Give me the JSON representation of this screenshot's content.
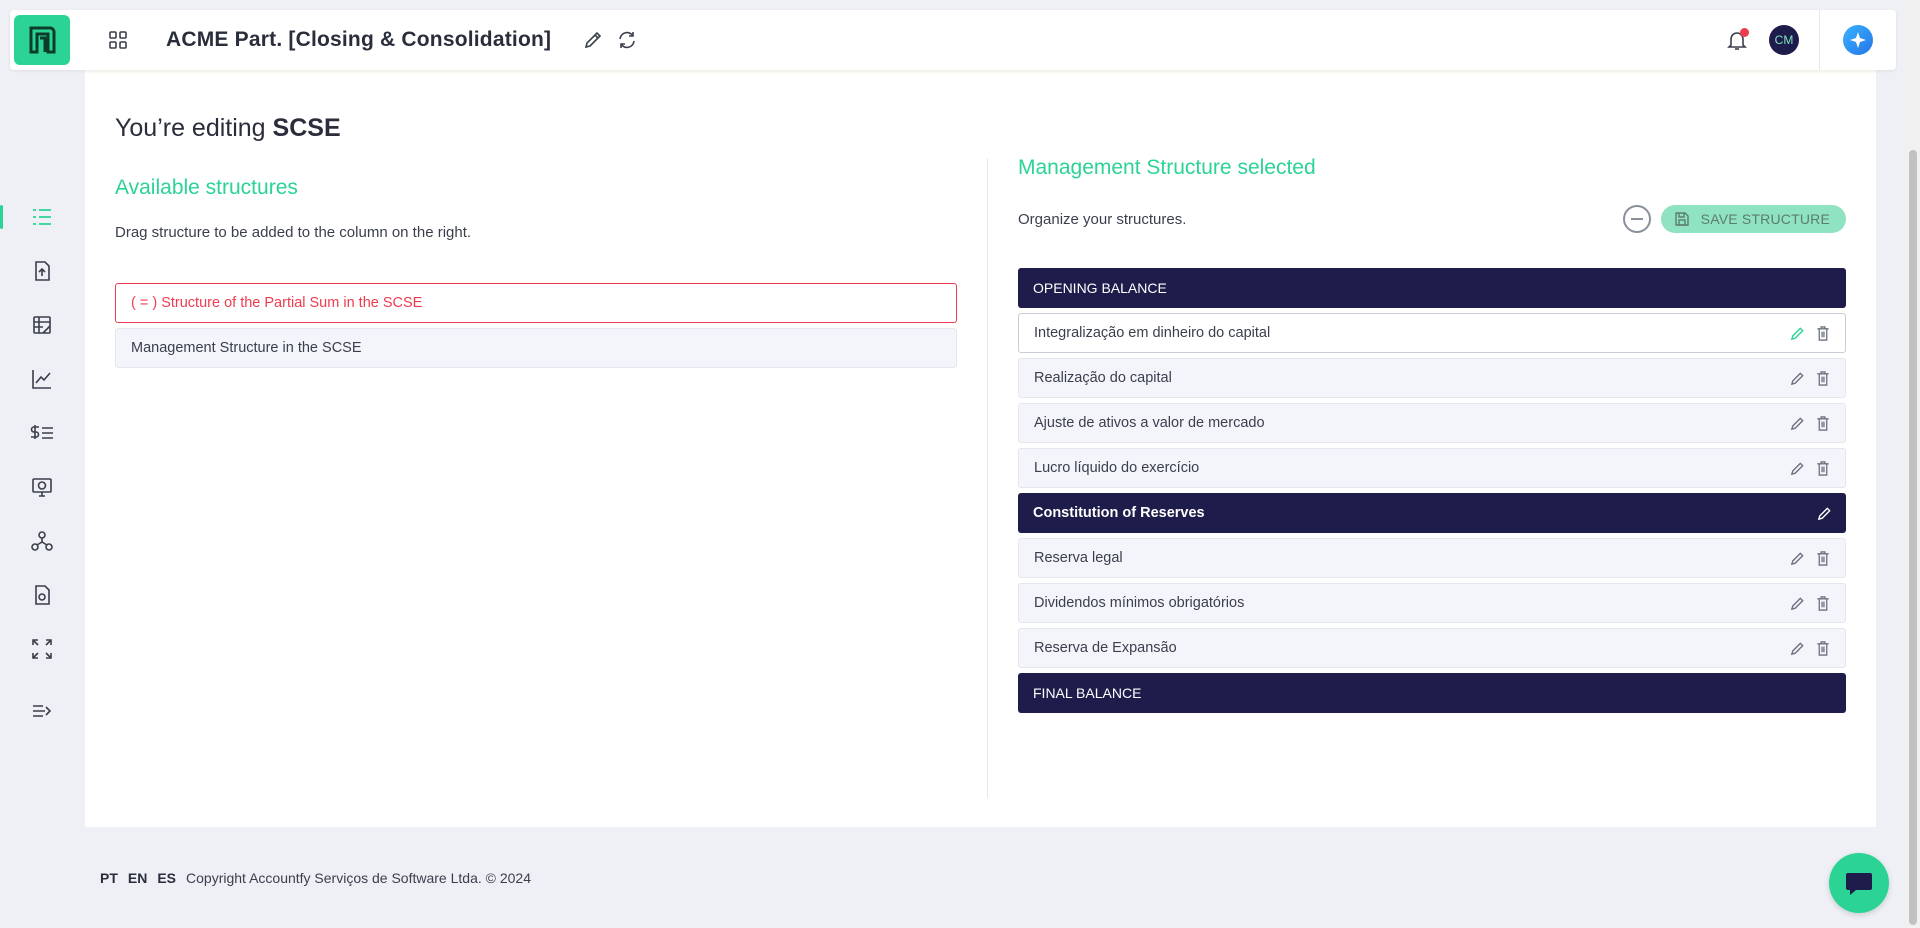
{
  "header": {
    "app_title": "ACME Part. [Closing & Consolidation]",
    "avatar_initials": "CM",
    "brand_color": "#2bd494",
    "notification_dot_color": "#ef3b4f"
  },
  "sidebar": {
    "items": [
      {
        "icon": "list-tree-icon",
        "active": true
      },
      {
        "icon": "file-upload-icon",
        "active": false
      },
      {
        "icon": "ledger-edit-icon",
        "active": false
      },
      {
        "icon": "line-chart-icon",
        "active": false
      },
      {
        "icon": "dollar-list-icon",
        "active": false
      },
      {
        "icon": "monitor-dollar-icon",
        "active": false
      },
      {
        "icon": "hierarchy-icon",
        "active": false
      },
      {
        "icon": "document-report-icon",
        "active": false
      },
      {
        "icon": "expand-dollar-icon",
        "active": false
      },
      {
        "icon": "collapse-menu-icon",
        "active": false
      }
    ]
  },
  "page": {
    "editing_prefix": "You’re editing",
    "editing_target": "SCSE"
  },
  "available": {
    "title": "Available structures",
    "helper": "Drag structure to be added to the column on the right.",
    "items": [
      {
        "label": "( = ) Structure of the Partial Sum in the SCSE",
        "state": "error"
      },
      {
        "label": "Management Structure in the SCSE",
        "state": "normal"
      }
    ]
  },
  "selected": {
    "title": "Management Structure selected",
    "helper": "Organize your structures.",
    "save_label": "SAVE STRUCTURE",
    "rows": [
      {
        "label": "OPENING BALANCE",
        "kind": "header"
      },
      {
        "label": "Integralização em dinheiro do capital",
        "kind": "item",
        "selected": true
      },
      {
        "label": "Realização do capital",
        "kind": "item"
      },
      {
        "label": "Ajuste de ativos a valor de mercado",
        "kind": "item"
      },
      {
        "label": "Lucro líquido do exercício",
        "kind": "item"
      },
      {
        "label": "Constitution of Reserves",
        "kind": "group"
      },
      {
        "label": "Reserva legal",
        "kind": "item"
      },
      {
        "label": "Dividendos mínimos obrigatórios",
        "kind": "item"
      },
      {
        "label": "Reserva de Expansão",
        "kind": "item"
      },
      {
        "label": "FINAL BALANCE",
        "kind": "header"
      }
    ]
  },
  "footer": {
    "languages": [
      "PT",
      "EN",
      "ES"
    ],
    "copyright": "Copyright Accountfy Serviços de Software Ltda. © 2024"
  }
}
